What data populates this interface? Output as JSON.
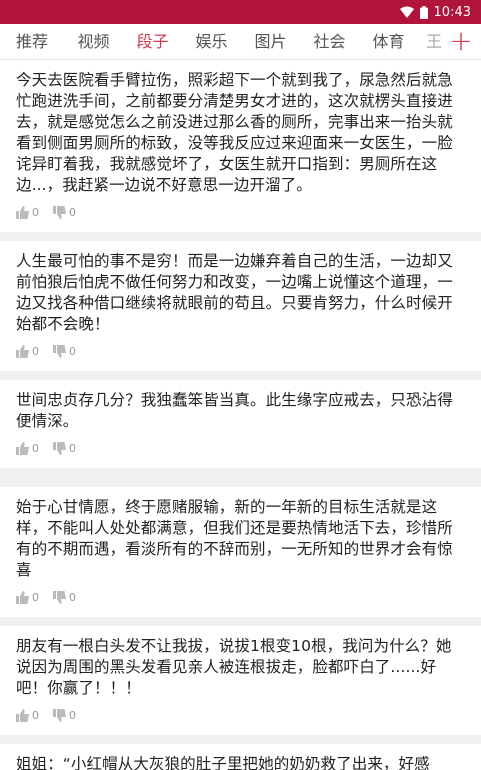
{
  "status": {
    "time": "10:43"
  },
  "tabs": [
    {
      "label": "推荐"
    },
    {
      "label": "视频"
    },
    {
      "label": "段子"
    },
    {
      "label": "娱乐"
    },
    {
      "label": "图片"
    },
    {
      "label": "社会"
    },
    {
      "label": "体育"
    },
    {
      "label": "王"
    }
  ],
  "add_label": "+",
  "posts": [
    {
      "text": "今天去医院看手臂拉伤，照彩超下一个就到我了，尿急然后就急忙跑进洗手间，之前都要分清楚男女才进的，这次就楞头直接进去，就是感觉怎么之前没进过那么香的厕所，完事出来一抬头就看到侧面男厕所的标致，没等我反应过来迎面来一女医生，一脸诧异盯着我，我就感觉坏了，女医生就开口指到：男厕所在这边...，我赶紧一边说不好意思一边开溜了。",
      "up": "0",
      "down": "0"
    },
    {
      "text": "人生最可怕的事不是穷！而是一边嫌弃着自己的生活，一边却又前怕狼后怕虎不做任何努力和改变，一边嘴上说懂这个道理，一边又找各种借口继续将就眼前的苟且。只要肯努力，什么时候开始都不会晚！",
      "up": "0",
      "down": "0"
    },
    {
      "text": "世间忠贞存几分？我独蠢笨皆当真。此生缘字应戒去，只恐沾得便情深。",
      "up": "0",
      "down": "0"
    },
    {
      "text": "始于心甘情愿，终于愿赌服输，新的一年新的目标生活就是这样，不能叫人处处都满意，但我们还是要热情地活下去，珍惜所有的不期而遇，看淡所有的不辞而别，一无所知的世界才会有惊喜",
      "up": "0",
      "down": "0"
    },
    {
      "text": "朋友有一根白头发不让我拔，说拔1根变10根，我问为什么？她说因为周围的黑头发看见亲人被连根拔走，脸都吓白了......好吧！你赢了！！！",
      "up": "0",
      "down": "0"
    },
    {
      "text": "姐姐：“小红帽从大灰狼的肚子里把她的奶奶救了出来，好感",
      "up": "",
      "down": ""
    }
  ]
}
